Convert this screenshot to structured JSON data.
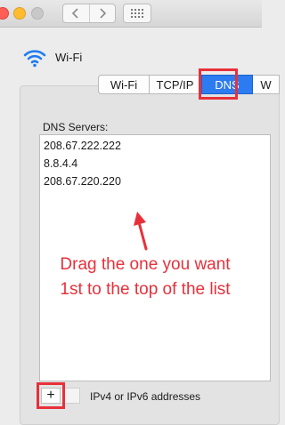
{
  "window": {
    "header_title": "Wi-Fi"
  },
  "tabs": [
    {
      "label": "Wi-Fi"
    },
    {
      "label": "TCP/IP"
    },
    {
      "label": "DNS"
    },
    {
      "label": "W"
    }
  ],
  "dns": {
    "section_label": "DNS Servers:",
    "servers": [
      "208.67.222.222",
      "8.8.4.4",
      "208.67.220.220"
    ],
    "add_label": "+",
    "hint": "IPv4 or IPv6 addresses"
  },
  "annotation": {
    "text": "Drag the one you want 1st to the top of the list",
    "color": "#e8303a"
  },
  "colors": {
    "selected_tab": "#2d7bf0",
    "wifi_icon": "#1e7cf2"
  },
  "icons": [
    "wifi-icon",
    "back-icon",
    "forward-icon",
    "grid-icon",
    "red-arrow-icon"
  ]
}
